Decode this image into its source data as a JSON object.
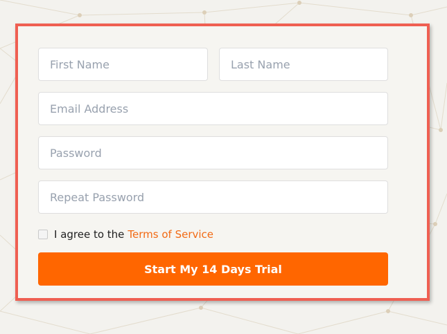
{
  "form": {
    "first_name": {
      "placeholder": "First Name",
      "value": ""
    },
    "last_name": {
      "placeholder": "Last Name",
      "value": ""
    },
    "email": {
      "placeholder": "Email Address",
      "value": ""
    },
    "password": {
      "placeholder": "Password",
      "value": ""
    },
    "repeat_password": {
      "placeholder": "Repeat Password",
      "value": ""
    },
    "terms": {
      "checked": false,
      "label": "I agree to the",
      "link_text": "Terms of Service"
    },
    "submit_label": "Start My 14 Days Trial"
  },
  "colors": {
    "accent": "#ff6600",
    "link": "#f26a14",
    "card_border": "#ef5f52",
    "background": "#f3f2ee"
  }
}
